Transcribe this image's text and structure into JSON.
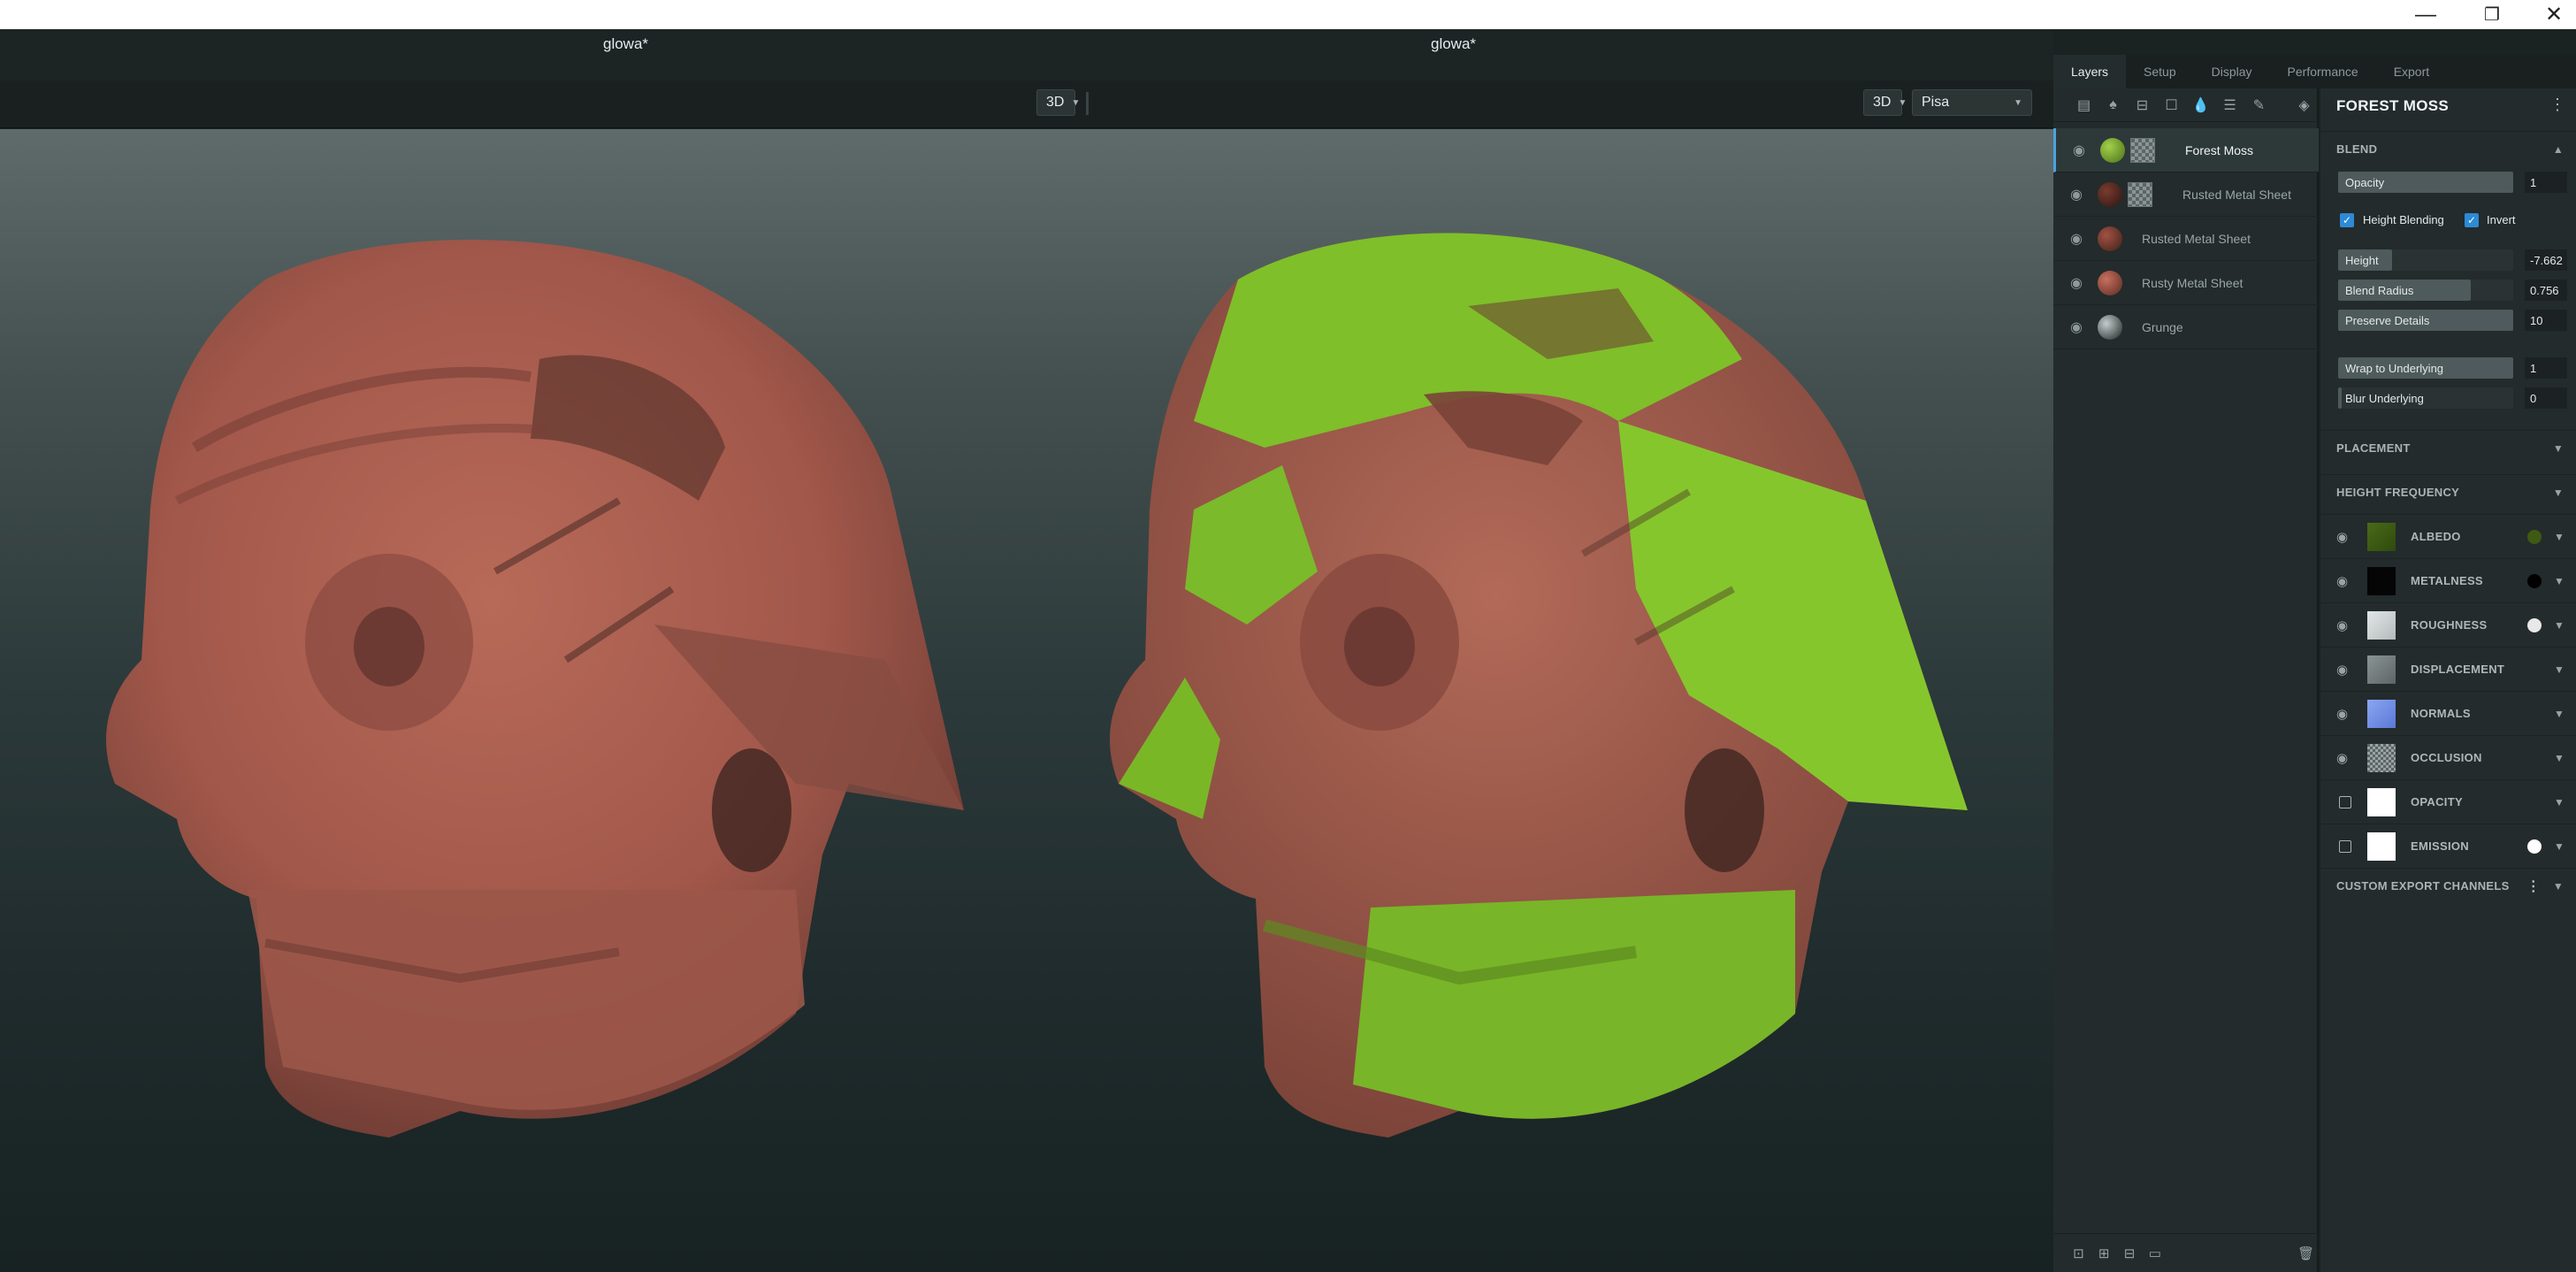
{
  "window": {
    "minimize": "—",
    "maximize": "❐",
    "close": "✕"
  },
  "documents": [
    {
      "title": "glowa*"
    },
    {
      "title": "glowa*"
    }
  ],
  "toolbar": {
    "left_mode": "3D",
    "right_mode": "3D",
    "environment": "Pisa"
  },
  "tabs": [
    "Layers",
    "Setup",
    "Display",
    "Performance",
    "Export"
  ],
  "layers": [
    {
      "name": "Forest Moss",
      "color": "#5f8a22",
      "has_mask": true,
      "selected": true
    },
    {
      "name": "Rusted Metal Sheet",
      "color": "#5a2d22",
      "has_mask": true,
      "selected": false
    },
    {
      "name": "Rusted Metal Sheet",
      "color": "#7a3a2c",
      "has_mask": false,
      "selected": false
    },
    {
      "name": "Rusty Metal Sheet",
      "color": "#9a4c3c",
      "has_mask": false,
      "selected": false
    },
    {
      "name": "Grunge",
      "color": "#3e4848",
      "has_mask": false,
      "selected": false
    }
  ],
  "props": {
    "title": "FOREST MOSS",
    "blend_section": "BLEND",
    "opacity": {
      "label": "Opacity",
      "value": "1"
    },
    "height_blending": "Height Blending",
    "invert": "Invert",
    "height": {
      "label": "Height",
      "value": "-7.662"
    },
    "blend_radius": {
      "label": "Blend Radius",
      "value": "0.756"
    },
    "preserve_details": {
      "label": "Preserve Details",
      "value": "10"
    },
    "wrap": {
      "label": "Wrap to Underlying",
      "value": "1"
    },
    "blur": {
      "label": "Blur Underlying",
      "value": "0"
    },
    "placement": "PLACEMENT",
    "height_frequency": "HEIGHT FREQUENCY",
    "channels": [
      {
        "name": "ALBEDO",
        "visible": true,
        "dot": "#3f5a12"
      },
      {
        "name": "METALNESS",
        "visible": true,
        "dot": "#000000"
      },
      {
        "name": "ROUGHNESS",
        "visible": true,
        "dot": "#e8e8e8"
      },
      {
        "name": "DISPLACEMENT",
        "visible": true,
        "dot": ""
      },
      {
        "name": "NORMALS",
        "visible": true,
        "dot": ""
      },
      {
        "name": "OCCLUSION",
        "visible": true,
        "dot": ""
      },
      {
        "name": "OPACITY",
        "visible": false,
        "dot": ""
      },
      {
        "name": "EMISSION",
        "visible": false,
        "dot": "#ffffff"
      }
    ],
    "custom_export": "CUSTOM EXPORT CHANNELS"
  }
}
